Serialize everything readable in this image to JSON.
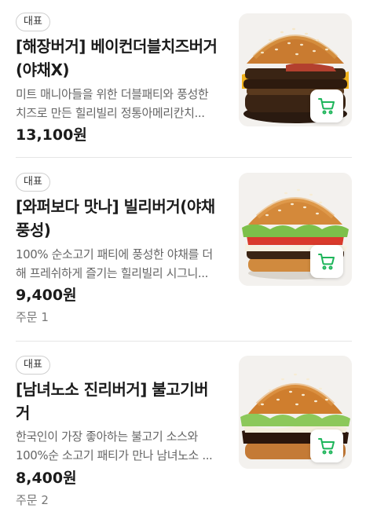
{
  "menu_items": [
    {
      "badge": "대표",
      "title_lines": [
        "[해장버거] 베이컨더블치즈버거",
        "(야채X)"
      ],
      "description_lines": [
        "미트 매니아들을 위한 더블패티와 풍성한",
        "치즈로 만든 힐리빌리 정통아메리칸치..."
      ],
      "price": "13,100원",
      "orders": "",
      "image_icon": "bacon-double-cheeseburger-photo",
      "cart_icon": "cart-icon"
    },
    {
      "badge": "대표",
      "title_lines": [
        "[와퍼보다 맛나] 빌리버거(야채",
        "풍성)"
      ],
      "description_lines": [
        "100% 순소고기 패티에 풍성한 야채를 더",
        "해 프레쉬하게 즐기는 힐리빌리 시그니..."
      ],
      "price": "9,400원",
      "orders": "주문 1",
      "image_icon": "billy-burger-photo",
      "cart_icon": "cart-icon"
    },
    {
      "badge": "대표",
      "title_lines": [
        "[남녀노소 진리버거] 불고기버",
        "거"
      ],
      "description_lines": [
        "한국인이 가장 좋아하는 불고기 소스와",
        "100%순 소고기 패티가 만나 남녀노소 ..."
      ],
      "price": "8,400원",
      "orders": "주문 2",
      "image_icon": "bulgogi-burger-photo",
      "cart_icon": "cart-icon"
    }
  ],
  "colors": {
    "accent_green": "#2ac1bc",
    "cart_green": "#1db55a",
    "text_primary": "#1b1b1b",
    "text_secondary": "#666666",
    "divider": "#e6e6e6"
  }
}
